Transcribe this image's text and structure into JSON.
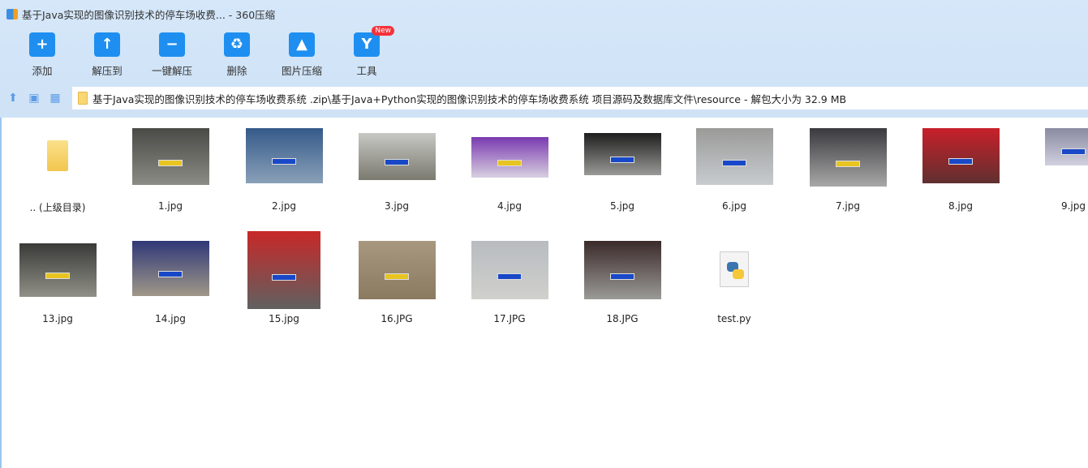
{
  "window": {
    "title": "基于Java实现的图像识别技术的停车场收费... - 360压缩"
  },
  "toolbar": [
    {
      "label": "添加",
      "icon": "add-folder-icon"
    },
    {
      "label": "解压到",
      "icon": "extract-to-icon"
    },
    {
      "label": "一键解压",
      "icon": "one-click-extract-icon"
    },
    {
      "label": "删除",
      "icon": "recycle-bin-icon"
    },
    {
      "label": "图片压缩",
      "icon": "image-compress-icon"
    },
    {
      "label": "工具",
      "icon": "tools-icon",
      "badge": "New"
    }
  ],
  "address": {
    "path": "基于Java实现的图像识别技术的停车场收费系统 .zip\\基于Java+Python实现的图像识别技术的停车场收费系统 项目源码及数据库文件\\resource - 解包大小为 32.9 MB"
  },
  "files": [
    {
      "name": ".. (上级目录)",
      "type": "parent"
    },
    {
      "name": "1.jpg",
      "type": "image"
    },
    {
      "name": "2.jpg",
      "type": "image"
    },
    {
      "name": "3.jpg",
      "type": "image"
    },
    {
      "name": "4.jpg",
      "type": "image"
    },
    {
      "name": "5.jpg",
      "type": "image"
    },
    {
      "name": "6.jpg",
      "type": "image"
    },
    {
      "name": "7.jpg",
      "type": "image"
    },
    {
      "name": "8.jpg",
      "type": "image"
    },
    {
      "name": "9.jpg",
      "type": "image"
    },
    {
      "name": "13.jpg",
      "type": "image"
    },
    {
      "name": "14.jpg",
      "type": "image"
    },
    {
      "name": "15.jpg",
      "type": "image"
    },
    {
      "name": "16.JPG",
      "type": "image"
    },
    {
      "name": "17.JPG",
      "type": "image"
    },
    {
      "name": "18.JPG",
      "type": "image"
    },
    {
      "name": "test.py",
      "type": "python"
    }
  ]
}
